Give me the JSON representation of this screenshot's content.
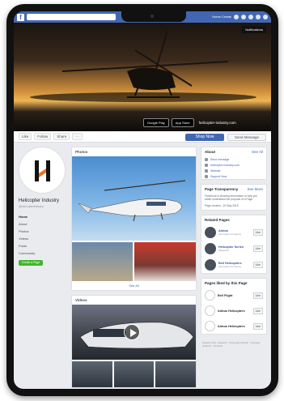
{
  "nav": {
    "links": "Home  Create"
  },
  "cover": {
    "notifications": "Notifications",
    "google_play": "Google Play",
    "app_store": "App Store",
    "site": "helicopter-industry.com"
  },
  "actions": {
    "like": "Like",
    "follow": "Follow",
    "share": "Share",
    "more": "···",
    "shop": "Shop Now",
    "message": "Send Message"
  },
  "page": {
    "name": "Helicopter Industry",
    "handle": "@helicopterindustry"
  },
  "leftnav": [
    "Home",
    "About",
    "Photos",
    "Videos",
    "Posts",
    "Community"
  ],
  "create_page": "Create a Page",
  "photos_title": "Photos",
  "see_all": "See All",
  "videos_title": "Videos",
  "about": {
    "title": "About",
    "see_all": "See All",
    "rows": [
      "Send message",
      "helicopter-industry.com",
      "Website",
      "Support Now"
    ]
  },
  "transparency": {
    "title": "Page Transparency",
    "see_more": "See More",
    "text": "Facebook is showing information to help you better understand the purpose of a Page.",
    "created": "Page created - 20 May 2015"
  },
  "related": {
    "title": "Related Pages",
    "items": [
      {
        "name": "Airbus",
        "sub": "Aerospace Company"
      },
      {
        "name": "Helicopter Series",
        "sub": "Magazine"
      },
      {
        "name": "Bell Helicopters",
        "sub": "Aerospace Company"
      }
    ]
  },
  "liked": {
    "title": "Pages liked by this Page",
    "items": [
      {
        "name": "Bell Flight"
      },
      {
        "name": "Airbus Helicopters"
      },
      {
        "name": "Airbus Helicopters"
      }
    ],
    "like": "Like"
  },
  "footer": "English (US) · Español · Português (Brasil) · Français (France) · Deutsch"
}
